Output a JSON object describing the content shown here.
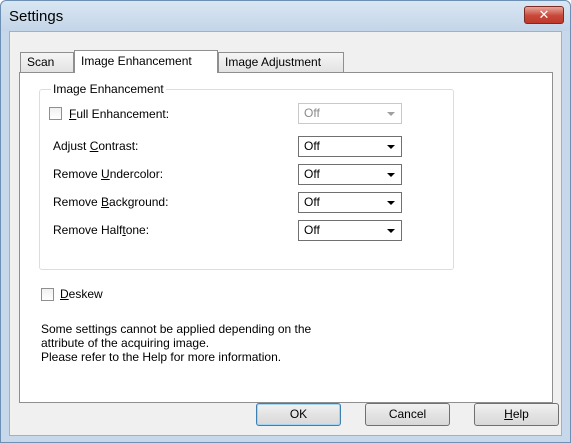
{
  "window": {
    "title": "Settings",
    "close_label": "✕"
  },
  "tabs": [
    {
      "label": "Scan",
      "active": false
    },
    {
      "label": "Image Enhancement",
      "active": true
    },
    {
      "label": "Image Adjustment",
      "active": false
    }
  ],
  "group": {
    "title": "Image Enhancement",
    "full_enhancement": {
      "prefix": "",
      "mnemonic": "F",
      "suffix": "ull Enhancement:",
      "checked": false,
      "value": "Off",
      "disabled": true
    },
    "rows": [
      {
        "prefix": "Adjust ",
        "mnemonic": "C",
        "suffix": "ontrast:",
        "value": "Off"
      },
      {
        "prefix": "Remove ",
        "mnemonic": "U",
        "suffix": "ndercolor:",
        "value": "Off"
      },
      {
        "prefix": "Remove ",
        "mnemonic": "B",
        "suffix": "ackground:",
        "value": "Off"
      },
      {
        "prefix": "Remove Half",
        "mnemonic": "t",
        "suffix": "one:",
        "value": "Off"
      }
    ]
  },
  "deskew": {
    "mnemonic": "D",
    "suffix": "eskew",
    "checked": false
  },
  "note": {
    "line1": "Some settings cannot be applied depending on the",
    "line2": "attribute of the acquiring image.",
    "line3": "Please refer to the Help for more information."
  },
  "buttons": {
    "ok": "OK",
    "cancel": "Cancel",
    "help_mnemonic": "H",
    "help_suffix": "elp"
  }
}
